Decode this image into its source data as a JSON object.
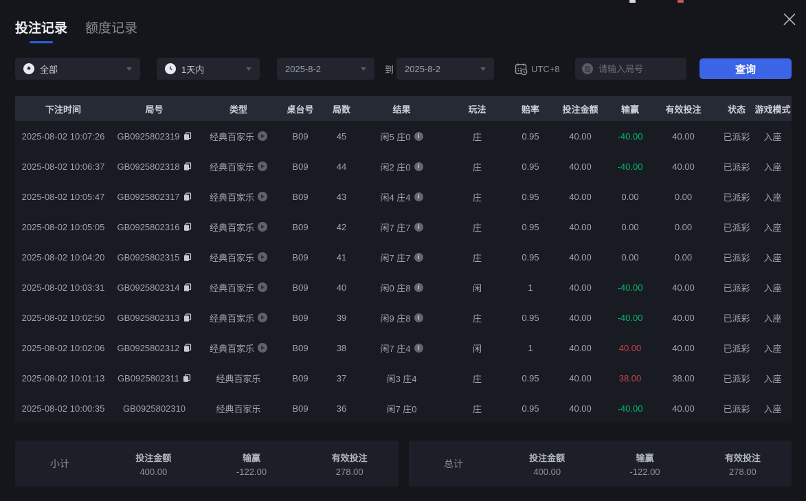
{
  "tabs": [
    {
      "label": "投注记录",
      "active": true
    },
    {
      "label": "额度记录",
      "active": false
    }
  ],
  "filters": {
    "game_type": "全部",
    "time_range": "1天内",
    "date_from": "2025-8-2",
    "to_label": "到",
    "date_to": "2025-8-2",
    "timezone": "UTC+8",
    "round_icon_text": "局",
    "round_placeholder": "请输入局号",
    "search_button": "查询"
  },
  "icons": {
    "close": "close-icon",
    "spade": "spade-icon",
    "clock": "clock-icon",
    "calendar_clock": "calendar-clock-icon",
    "round_number": "round-number-icon",
    "chevron": "chevron-down-icon",
    "copy": "copy-icon",
    "video": "video-icon",
    "info": "info-icon"
  },
  "colors": {
    "accent_blue": "#3c64e6",
    "win_red": "#c8414b",
    "loss_green": "#00b96a"
  },
  "table": {
    "columns": [
      "下注时间",
      "局号",
      "类型",
      "桌台号",
      "局数",
      "结果",
      "玩法",
      "赔率",
      "投注金额",
      "输赢",
      "有效投注",
      "状态",
      "游戏模式"
    ],
    "column_keys": [
      "time",
      "round",
      "type",
      "table_no",
      "round_count",
      "result",
      "play",
      "odds",
      "bet",
      "win_loss",
      "valid_bet",
      "status",
      "mode"
    ],
    "rows": [
      {
        "time": "2025-08-02 10:07:26",
        "round": "GB0925802319",
        "has_copy_icon": true,
        "type": "经典百家乐",
        "has_video_icon": true,
        "table_no": "B09",
        "round_count": "45",
        "result": "闲5 庄0",
        "has_info_icon": true,
        "play": "庄",
        "odds": "0.95",
        "bet": "40.00",
        "win_loss": "-40.00",
        "win_loss_color": "green",
        "valid_bet": "40.00",
        "status": "已派彩",
        "mode": "入座"
      },
      {
        "time": "2025-08-02 10:06:37",
        "round": "GB0925802318",
        "has_copy_icon": true,
        "type": "经典百家乐",
        "has_video_icon": true,
        "table_no": "B09",
        "round_count": "44",
        "result": "闲2 庄0",
        "has_info_icon": true,
        "play": "庄",
        "odds": "0.95",
        "bet": "40.00",
        "win_loss": "-40.00",
        "win_loss_color": "green",
        "valid_bet": "40.00",
        "status": "已派彩",
        "mode": "入座"
      },
      {
        "time": "2025-08-02 10:05:47",
        "round": "GB0925802317",
        "has_copy_icon": true,
        "type": "经典百家乐",
        "has_video_icon": true,
        "table_no": "B09",
        "round_count": "43",
        "result": "闲4 庄4",
        "has_info_icon": true,
        "play": "庄",
        "odds": "0.95",
        "bet": "40.00",
        "win_loss": "0.00",
        "win_loss_color": "",
        "valid_bet": "0.00",
        "status": "已派彩",
        "mode": "入座"
      },
      {
        "time": "2025-08-02 10:05:05",
        "round": "GB0925802316",
        "has_copy_icon": true,
        "type": "经典百家乐",
        "has_video_icon": true,
        "table_no": "B09",
        "round_count": "42",
        "result": "闲7 庄7",
        "has_info_icon": true,
        "play": "庄",
        "odds": "0.95",
        "bet": "40.00",
        "win_loss": "0.00",
        "win_loss_color": "",
        "valid_bet": "0.00",
        "status": "已派彩",
        "mode": "入座"
      },
      {
        "time": "2025-08-02 10:04:20",
        "round": "GB0925802315",
        "has_copy_icon": true,
        "type": "经典百家乐",
        "has_video_icon": true,
        "table_no": "B09",
        "round_count": "41",
        "result": "闲7 庄7",
        "has_info_icon": true,
        "play": "庄",
        "odds": "0.95",
        "bet": "40.00",
        "win_loss": "0.00",
        "win_loss_color": "",
        "valid_bet": "0.00",
        "status": "已派彩",
        "mode": "入座"
      },
      {
        "time": "2025-08-02 10:03:31",
        "round": "GB0925802314",
        "has_copy_icon": true,
        "type": "经典百家乐",
        "has_video_icon": true,
        "table_no": "B09",
        "round_count": "40",
        "result": "闲0 庄8",
        "has_info_icon": true,
        "play": "闲",
        "odds": "1",
        "bet": "40.00",
        "win_loss": "-40.00",
        "win_loss_color": "green",
        "valid_bet": "40.00",
        "status": "已派彩",
        "mode": "入座"
      },
      {
        "time": "2025-08-02 10:02:50",
        "round": "GB0925802313",
        "has_copy_icon": true,
        "type": "经典百家乐",
        "has_video_icon": true,
        "table_no": "B09",
        "round_count": "39",
        "result": "闲9 庄8",
        "has_info_icon": true,
        "play": "庄",
        "odds": "0.95",
        "bet": "40.00",
        "win_loss": "-40.00",
        "win_loss_color": "green",
        "valid_bet": "40.00",
        "status": "已派彩",
        "mode": "入座"
      },
      {
        "time": "2025-08-02 10:02:06",
        "round": "GB0925802312",
        "has_copy_icon": true,
        "type": "经典百家乐",
        "has_video_icon": true,
        "table_no": "B09",
        "round_count": "38",
        "result": "闲7 庄4",
        "has_info_icon": true,
        "play": "闲",
        "odds": "1",
        "bet": "40.00",
        "win_loss": "40.00",
        "win_loss_color": "red",
        "valid_bet": "40.00",
        "status": "已派彩",
        "mode": "入座"
      },
      {
        "time": "2025-08-02 10:01:13",
        "round": "GB0925802311",
        "has_copy_icon": true,
        "type": "经典百家乐",
        "has_video_icon": false,
        "table_no": "B09",
        "round_count": "37",
        "result": "闲3 庄4",
        "has_info_icon": false,
        "play": "庄",
        "odds": "0.95",
        "bet": "40.00",
        "win_loss": "38.00",
        "win_loss_color": "red",
        "valid_bet": "38.00",
        "status": "已派彩",
        "mode": "入座"
      },
      {
        "time": "2025-08-02 10:00:35",
        "round": "GB0925802310",
        "has_copy_icon": false,
        "type": "经典百家乐",
        "has_video_icon": false,
        "table_no": "B09",
        "round_count": "36",
        "result": "闲7 庄0",
        "has_info_icon": false,
        "play": "庄",
        "odds": "0.95",
        "bet": "40.00",
        "win_loss": "-40.00",
        "win_loss_color": "green",
        "valid_bet": "40.00",
        "status": "已派彩",
        "mode": "入座"
      }
    ]
  },
  "summaries": [
    {
      "label": "小计",
      "stats": [
        {
          "label": "投注金额",
          "value": "400.00",
          "color": ""
        },
        {
          "label": "输赢",
          "value": "-122.00",
          "color": "green"
        },
        {
          "label": "有效投注",
          "value": "278.00",
          "color": ""
        }
      ]
    },
    {
      "label": "总计",
      "stats": [
        {
          "label": "投注金额",
          "value": "400.00",
          "color": ""
        },
        {
          "label": "输赢",
          "value": "-122.00",
          "color": "green"
        },
        {
          "label": "有效投注",
          "value": "278.00",
          "color": ""
        }
      ]
    }
  ]
}
